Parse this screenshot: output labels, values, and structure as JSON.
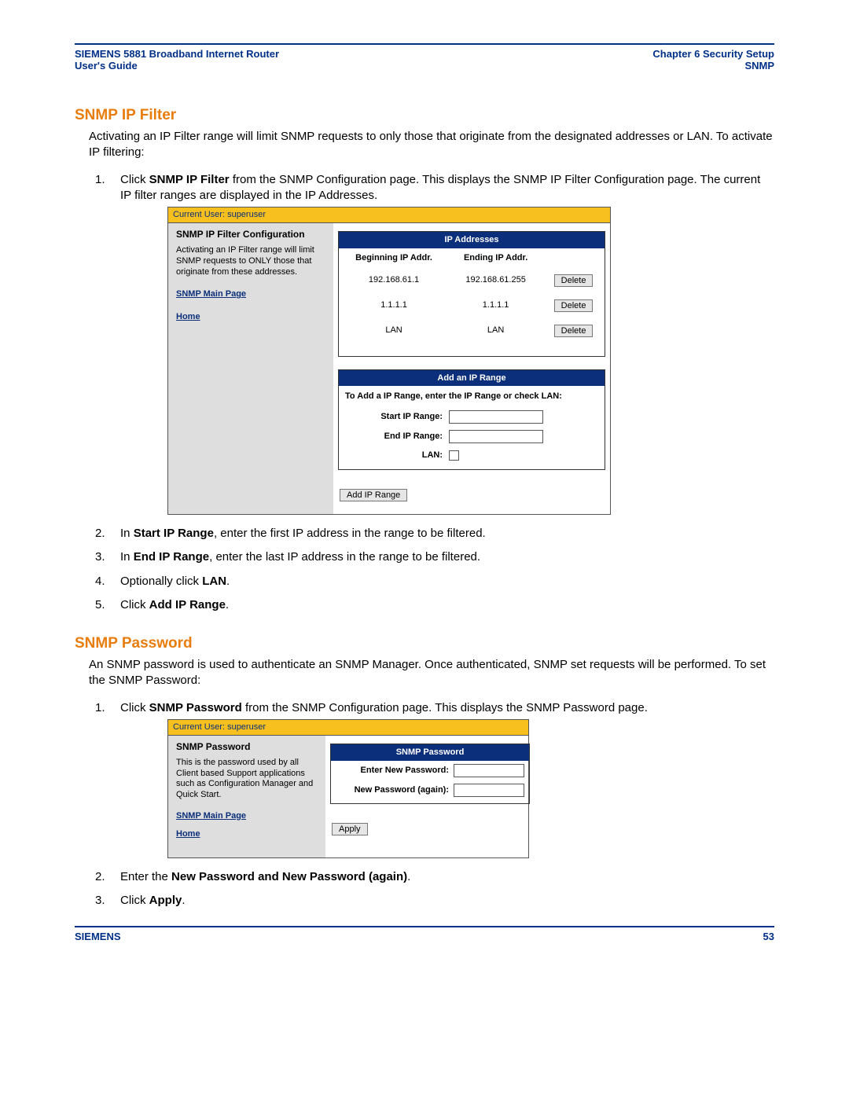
{
  "header": {
    "left_line1": "SIEMENS 5881 Broadband Internet Router",
    "left_line2": "User's Guide",
    "right_line1": "Chapter 6  Security Setup",
    "right_line2": "SNMP"
  },
  "section1": {
    "title": "SNMP IP Filter",
    "intro": "Activating an IP Filter range will limit SNMP requests to only those that originate from the designated addresses or LAN. To activate IP filtering:",
    "step1_pre": "Click ",
    "step1_b": "SNMP IP Filter",
    "step1_post": " from the SNMP Configuration page. This displays the SNMP IP Filter Configuration page. The current IP filter ranges are displayed in the IP Addresses.",
    "step2_pre": "In ",
    "step2_b": "Start IP Range",
    "step2_post": ", enter the first IP address in the range to be filtered.",
    "step3_pre": "In ",
    "step3_b": "End IP Range",
    "step3_post": ", enter the last IP address in the range to be filtered.",
    "step4_pre": "Optionally click ",
    "step4_b": "LAN",
    "step4_post": ".",
    "step5_pre": "Click ",
    "step5_b": "Add IP Range",
    "step5_post": "."
  },
  "embed1": {
    "userbar": "Current User: superuser",
    "sidebar_title": "SNMP IP Filter Configuration",
    "sidebar_desc": "Activating an IP Filter range will limit SNMP requests to ONLY those that originate from these addresses.",
    "link_main": "SNMP Main Page",
    "link_home": "Home",
    "iptable_h": "IP Addresses",
    "col_begin": "Beginning IP Addr.",
    "col_end": "Ending IP Addr.",
    "rows": [
      {
        "begin": "192.168.61.1",
        "end": "192.168.61.255",
        "btn": "Delete"
      },
      {
        "begin": "1.1.1.1",
        "end": "1.1.1.1",
        "btn": "Delete"
      },
      {
        "begin": "LAN",
        "end": "LAN",
        "btn": "Delete"
      }
    ],
    "addrange_h": "Add an IP Range",
    "addrange_desc": "To Add a IP Range, enter the IP Range or check LAN:",
    "label_start": "Start IP Range:",
    "label_end": "End IP Range:",
    "label_lan": "LAN:",
    "add_btn": "Add IP Range"
  },
  "section2": {
    "title": "SNMP Password",
    "intro": "An SNMP password is used to authenticate an SNMP Manager. Once authenticated, SNMP set requests will be performed. To set the SNMP Password:",
    "step1_pre": "Click ",
    "step1_b": "SNMP Password",
    "step1_post": " from the SNMP Configuration page. This displays the SNMP Password page.",
    "step2_pre": "Enter the ",
    "step2_b": "New Password and New Password (again)",
    "step2_post": ".",
    "step3_pre": "Click ",
    "step3_b": "Apply",
    "step3_post": "."
  },
  "embed2": {
    "userbar": "Current User: superuser",
    "sidebar_title": "SNMP Password",
    "sidebar_desc": "This is the password used by all Client based Support applications such as Configuration Manager and Quick Start.",
    "link_main": "SNMP Main Page",
    "link_home": "Home",
    "panel_h": "SNMP Password",
    "label_new": "Enter New Password:",
    "label_again": "New Password (again):",
    "apply_btn": "Apply"
  },
  "footer": {
    "left": "SIEMENS",
    "right": "53"
  }
}
